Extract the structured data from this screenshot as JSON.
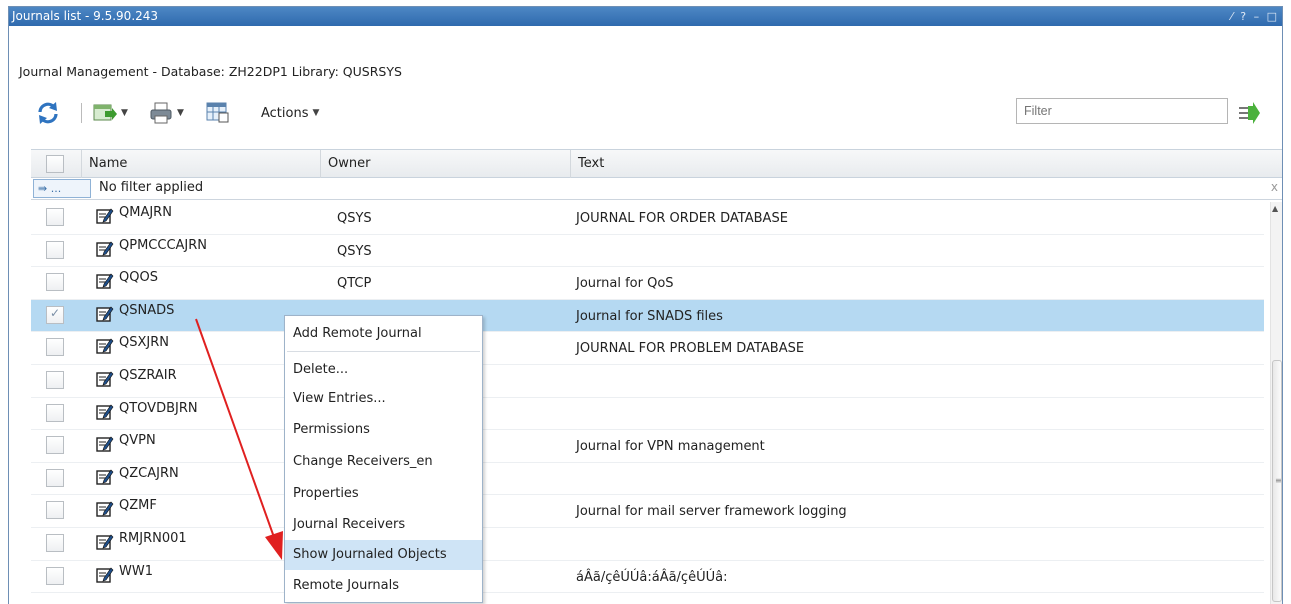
{
  "window": {
    "title": "Journals list - 9.5.90.243",
    "controls": [
      "⁄",
      "?",
      "–",
      "□"
    ]
  },
  "subtitle": "Journal Management - Database: ZH22DP1 Library: QUSRSYS",
  "toolbar": {
    "actions_label": "Actions",
    "filter_placeholder": "Filter"
  },
  "grid": {
    "columns": [
      "Name",
      "Owner",
      "Text"
    ],
    "filter_status": "No filter applied",
    "filter_button_label": "⇛ ...",
    "rows": [
      {
        "name": "QMAJRN",
        "owner": "QSYS",
        "text": "JOURNAL FOR ORDER DATABASE",
        "selected": false
      },
      {
        "name": "QPMCCCAJRN",
        "owner": "QSYS",
        "text": "",
        "selected": false
      },
      {
        "name": "QQOS",
        "owner": "QTCP",
        "text": "Journal for QoS",
        "selected": false
      },
      {
        "name": "QSNADS",
        "owner": "",
        "text": "Journal for SNADS files",
        "selected": true
      },
      {
        "name": "QSXJRN",
        "owner": "",
        "text": "JOURNAL FOR PROBLEM DATABASE",
        "selected": false
      },
      {
        "name": "QSZRAIR",
        "owner": "",
        "text": "",
        "selected": false
      },
      {
        "name": "QTOVDBJRN",
        "owner": "",
        "text": "",
        "selected": false
      },
      {
        "name": "QVPN",
        "owner": "",
        "text": "Journal for VPN management",
        "selected": false
      },
      {
        "name": "QZCAJRN",
        "owner": "",
        "text": "",
        "selected": false
      },
      {
        "name": "QZMF",
        "owner": "",
        "text": "Journal for mail server framework logging",
        "selected": false
      },
      {
        "name": "RMJRN001",
        "owner": "",
        "text": "",
        "selected": false
      },
      {
        "name": "WW1",
        "owner": "",
        "text": "áÂã/çêÚÚâ:áÂã/çêÚÚâ:",
        "selected": false
      }
    ]
  },
  "context_menu": {
    "items": [
      {
        "label": "Add Remote Journal",
        "hover": false
      },
      {
        "label": "Delete...",
        "hover": false
      },
      {
        "label": "View Entries...",
        "hover": false
      },
      {
        "label": "Permissions",
        "hover": false
      },
      {
        "label": "Change Receivers_en",
        "hover": false
      },
      {
        "label": "Properties",
        "hover": false
      },
      {
        "label": "Journal Receivers",
        "hover": false
      },
      {
        "label": "Show Journaled Objects",
        "hover": true
      },
      {
        "label": "Remote Journals",
        "hover": false
      }
    ]
  },
  "colors": {
    "titlebar": "#3a78ba",
    "selected_row": "#b5d9f2",
    "menu_hover": "#cfe4f6",
    "arrow": "#e02020"
  },
  "icons": {
    "toolbar": [
      "refresh-icon",
      "export-icon",
      "print-icon",
      "table-settings-icon",
      "apply-filter-icon"
    ],
    "row": "journal-icon"
  }
}
